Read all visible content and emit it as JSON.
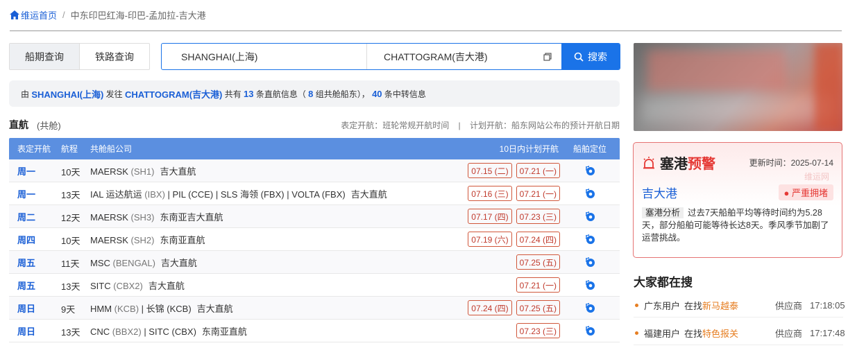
{
  "breadcrumb": {
    "home": "维运首页",
    "separator": "/",
    "current": "中东印巴红海-印巴-孟加拉-吉大港"
  },
  "tabs": [
    {
      "label": "船期查询",
      "active": true
    },
    {
      "label": "铁路查询",
      "active": false
    }
  ],
  "search": {
    "from": "SHANGHAI(上海)",
    "to": "CHATTOGRAM(吉大港)",
    "button": "搜索"
  },
  "info": {
    "p1": "由 ",
    "from": "SHANGHAI(上海)",
    "p2": " 发往 ",
    "to": "CHATTOGRAM(吉大港)",
    "p3": " 共有 ",
    "direct": "13",
    "p4": " 条直航信息（ ",
    "groups": "8",
    "p5": " 组共舱船东）， ",
    "transfer": "40",
    "p6": " 条中转信息"
  },
  "subhead": {
    "title": "直航",
    "sub": "(共舱)",
    "legend": "表定开航：班轮常规开航时间    |    计划开航：船东网站公布的预计开航日期"
  },
  "table": {
    "headers": {
      "day": "表定开航",
      "duration": "航程",
      "company": "共舱船公司",
      "plan": "10日内计划开航",
      "locate": "船舶定位"
    },
    "rows": [
      {
        "day": "周一",
        "duration": "10天",
        "carrier": "MAERSK",
        "code": "(SH1)",
        "route": "吉大直航",
        "d1": "07.15 (二)",
        "d2": "07.21 (一)"
      },
      {
        "day": "周一",
        "duration": "13天",
        "carrier": "IAL 运达航运",
        "code": "(IBX)",
        "more": " | PIL (CCE) | SLS 海领 (FBX) | VOLTA (FBX)",
        "route": "吉大直航",
        "d1": "07.16 (三)",
        "d2": "07.21 (一)"
      },
      {
        "day": "周二",
        "duration": "12天",
        "carrier": "MAERSK",
        "code": "(SH3)",
        "route": "东南亚吉大直航",
        "d1": "07.17 (四)",
        "d2": "07.23 (三)"
      },
      {
        "day": "周四",
        "duration": "10天",
        "carrier": "MAERSK",
        "code": "(SH2)",
        "route": "东南亚直航",
        "d1": "07.19 (六)",
        "d2": "07.24 (四)"
      },
      {
        "day": "周五",
        "duration": "11天",
        "carrier": "MSC",
        "code": "(BENGAL)",
        "route": "吉大直航",
        "d1": "",
        "d2": "07.25 (五)"
      },
      {
        "day": "周五",
        "duration": "13天",
        "carrier": "SITC",
        "code": "(CBX2)",
        "route": "吉大直航",
        "d1": "",
        "d2": "07.21 (一)"
      },
      {
        "day": "周日",
        "duration": "9天",
        "carrier": "HMM",
        "code": "(KCB)",
        "more": " | 长锦 (KCB)",
        "route": "吉大直航",
        "d1": "07.24 (四)",
        "d2": "07.25 (五)"
      },
      {
        "day": "周日",
        "duration": "13天",
        "carrier": "CNC",
        "code": "(BBX2)",
        "more": " | SITC (CBX)",
        "route": "东南亚直航",
        "d1": "",
        "d2": "07.23 (三)"
      }
    ]
  },
  "alert": {
    "title_a": "塞港",
    "title_b": "预警",
    "updated": "更新时间：2025-07-14",
    "watermark": "维运网",
    "port": "吉大港",
    "badge": "严重拥堵",
    "tag": "塞港分析",
    "text": "过去7天船舶平均等待时间约为5.28天，部分船舶可能等待长达8天。季风季节加剧了运营挑战。"
  },
  "hot": {
    "title": "大家都在搜",
    "items": [
      {
        "user": "广东用户",
        "verb": "在找",
        "keyword": "新马越泰",
        "type": "供应商",
        "time": "17:18:05"
      },
      {
        "user": "福建用户",
        "verb": "在找",
        "keyword": "特色报关",
        "type": "供应商",
        "time": "17:17:48"
      }
    ]
  },
  "colors": {
    "accent": "#1a73e8",
    "link": "#1a5fd6",
    "header": "#5b8fe0",
    "danger": "#e53935",
    "warn": "#e67e22"
  }
}
